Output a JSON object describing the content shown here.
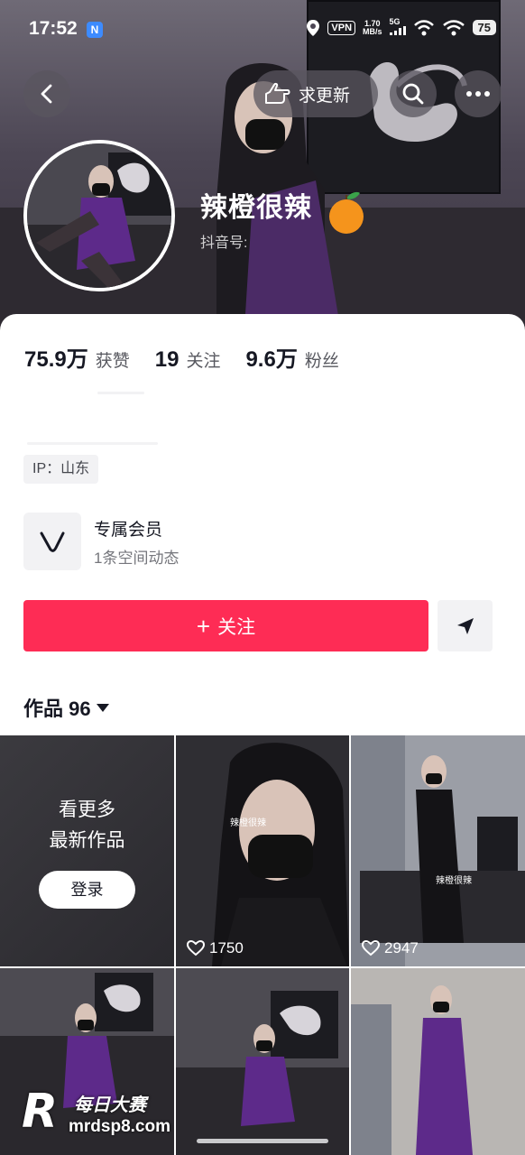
{
  "status_bar": {
    "time": "17:52",
    "app_badge": "N",
    "vpn": "VPN",
    "speed_value": "1.70",
    "speed_unit": "MB/s",
    "network": "5G",
    "battery": "75"
  },
  "header": {
    "request_update_label": "求更新",
    "nickname": "辣橙很辣",
    "douyin_id_label": "抖音号:"
  },
  "stats": {
    "likes_value": "75.9万",
    "likes_label": "获赞",
    "following_value": "19",
    "following_label": "关注",
    "followers_value": "9.6万",
    "followers_label": "粉丝"
  },
  "ip_tag": "IP：山东",
  "member": {
    "title": "专属会员",
    "subtitle": "1条空间动态"
  },
  "actions": {
    "follow_label": "关注",
    "follow_plus": "+"
  },
  "works_tab": {
    "label": "作品 96"
  },
  "grid": {
    "locked_line1": "看更多",
    "locked_line2": "最新作品",
    "login_label": "登录",
    "tile2_likes": "1750",
    "tile2_caption": "辣橙很辣",
    "tile3_likes": "2947",
    "tile3_caption": "辣橙很辣"
  },
  "watermark": {
    "letter": "R",
    "line1": "每日大赛",
    "line2": "mrdsp8.com"
  },
  "colors": {
    "accent": "#fe2c55",
    "text_primary": "#161823",
    "text_secondary": "#57585f"
  }
}
